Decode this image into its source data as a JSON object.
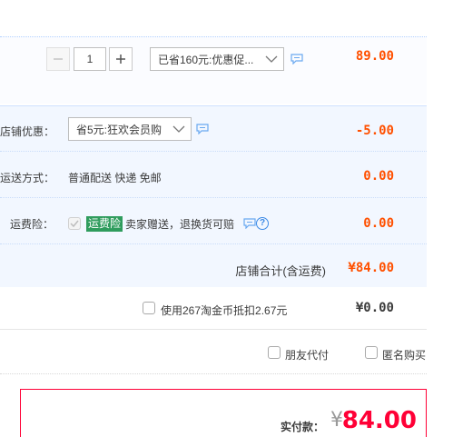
{
  "item": {
    "quantity": "1",
    "promo_select": "已省160元:优惠促...",
    "price": "89.00"
  },
  "shop": {
    "discount_label": "店铺优惠：",
    "discount_select": "省5元:狂欢会员购",
    "discount_value": "-5.00",
    "shipping_label": "运送方式：",
    "shipping_text": "普通配送 快递 免邮",
    "shipping_value": "0.00",
    "insurance_label": "运费险：",
    "insurance_badge": "运费险",
    "insurance_text": "卖家赠送，退换货可赔",
    "insurance_help": "?",
    "insurance_value": "0.00",
    "total_label": "店铺合计(含运费)",
    "total_value": "¥84.00"
  },
  "coins": {
    "label": "使用267淘金币抵扣2.67元",
    "value": "¥0.00"
  },
  "options": {
    "friend_pay": "朋友代付",
    "anonymous": "匿名购买"
  },
  "payment": {
    "label": "实付款：",
    "yen": "¥",
    "amount": "84.00"
  },
  "colors": {
    "accent": "#ff5000",
    "pay_red": "#ff0036",
    "badge_green": "#2f9c5d",
    "link_blue": "#3c8ae6"
  },
  "icons": [
    "minus-icon",
    "plus-icon",
    "chevron-down-icon",
    "comment-icon",
    "check-icon",
    "help-icon"
  ]
}
